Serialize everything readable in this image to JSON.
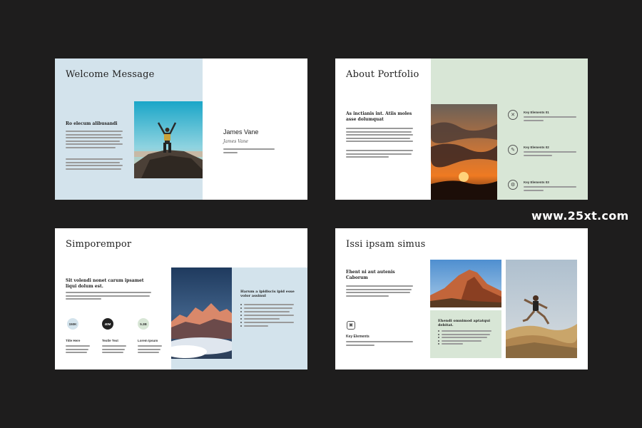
{
  "watermark": "www.25xt.com",
  "slide1": {
    "title": "Welcome Message",
    "subhead": "Ro elecum alibusandi",
    "name": "James Vane",
    "signature": "James Vane",
    "colors": {
      "panel": "#d3e3ec"
    }
  },
  "slide2": {
    "title": "About Portfolio",
    "subhead": "As inctianis int. Atiis moles asse dolumquat",
    "elements": [
      {
        "label": "Key Elements 01",
        "icon": "tools-icon"
      },
      {
        "label": "Key Elements 02",
        "icon": "edit-icon"
      },
      {
        "label": "Key Elements 03",
        "icon": "gear-icon"
      }
    ],
    "colors": {
      "panel": "#d8e6d6"
    }
  },
  "slide3": {
    "title": "Simporempor",
    "subhead": "Sit volendi nonet carum ipsamet liqui dolum est.",
    "stats": [
      {
        "value": "150K",
        "label": "Title Here",
        "bg": "#d3e3ec",
        "fg": "#333333"
      },
      {
        "value": "40M",
        "label": "Textle Text",
        "bg": "#222222",
        "fg": "#ffffff"
      },
      {
        "value": "5.3B",
        "label": "Lorem Ipsum",
        "bg": "#d8e6d6",
        "fg": "#333333"
      }
    ],
    "panel_subhead": "Harum a ipidiscis ipid esse volor assinul",
    "colors": {
      "panel": "#d3e3ec"
    }
  },
  "slide4": {
    "title": "Issi ipsam simus",
    "subhead": "Ehent ni aut autenis Caborum",
    "key_label": "Key Elements",
    "panel_subhead": "Ehendi omnimod aptatqui debitat.",
    "colors": {
      "panel": "#d8e6d6"
    }
  }
}
